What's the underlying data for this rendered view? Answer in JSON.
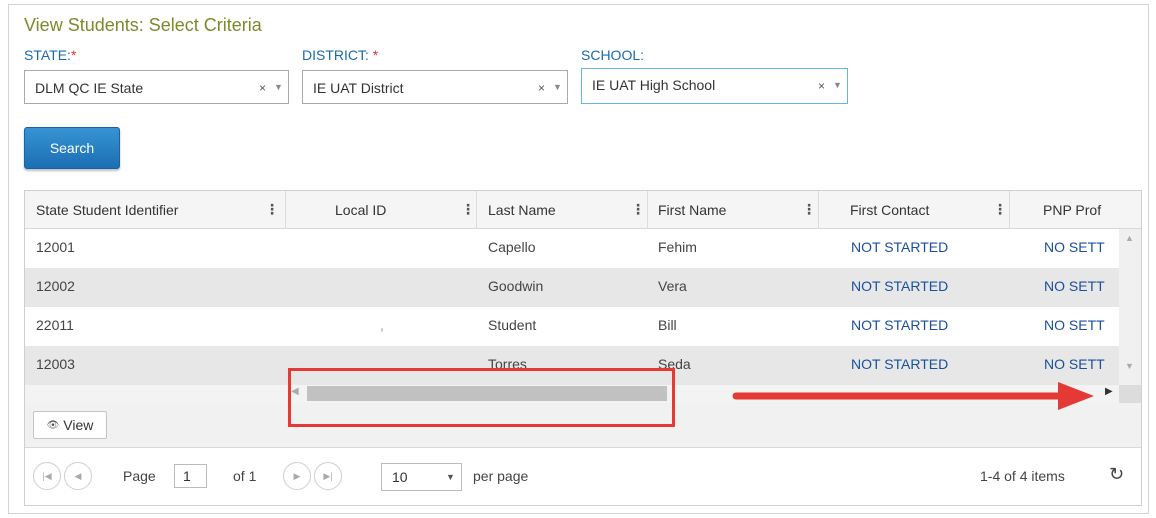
{
  "page_title": "View Students: Select Criteria",
  "filters": {
    "state": {
      "label": "STATE:",
      "required": "*",
      "value": "DLM QC IE State"
    },
    "district": {
      "label": "DISTRICT:",
      "required": " *",
      "value": "IE UAT District"
    },
    "school": {
      "label": "SCHOOL:",
      "value": "IE UAT High School"
    },
    "clear_glyph": "×",
    "arrow_glyph": "▼"
  },
  "search_label": "Search",
  "grid": {
    "columns": [
      "State Student Identifier",
      "Local ID",
      "Last Name",
      "First Name",
      "First Contact",
      "PNP Prof"
    ],
    "menu_glyph": "⋮",
    "rows": [
      {
        "ssid": "12001",
        "local_id": "",
        "last": "Capello",
        "first": "Fehim",
        "contact": "NOT STARTED",
        "pnp": "NO SETT"
      },
      {
        "ssid": "12002",
        "local_id": "",
        "last": "Goodwin",
        "first": "Vera",
        "contact": "NOT STARTED",
        "pnp": "NO SETT"
      },
      {
        "ssid": "22011",
        "local_id": ",",
        "last": "Student",
        "first": "Bill",
        "contact": "NOT STARTED",
        "pnp": "NO SETT"
      },
      {
        "ssid": "12003",
        "local_id": "",
        "last": "Torres",
        "first": "Seda",
        "contact": "NOT STARTED",
        "pnp": "NO SETT"
      }
    ]
  },
  "view_button": "View",
  "pager": {
    "page_label": "Page",
    "page_value": "1",
    "of_label": "of 1",
    "page_size": "10",
    "per_page_label": "per page",
    "items_summary": "1-4 of 4 items"
  },
  "colors": {
    "annotation": "#e53935",
    "link": "#1a4f9a",
    "title": "#7b8b2a",
    "button": "#1b6fb3"
  }
}
